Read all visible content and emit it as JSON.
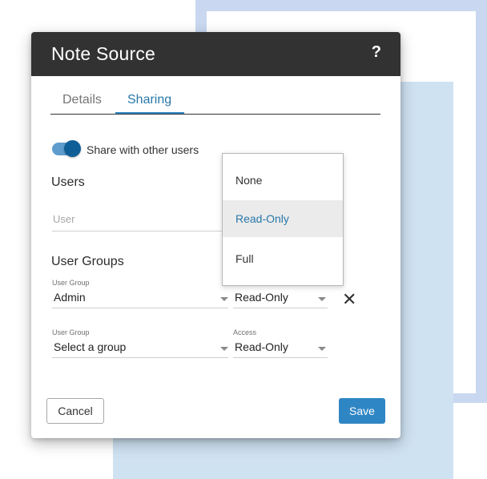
{
  "dialog": {
    "title": "Note Source",
    "help": "?"
  },
  "tabs": [
    {
      "label": "Details",
      "active": false
    },
    {
      "label": "Sharing",
      "active": true
    }
  ],
  "share": {
    "label": "Share with other users",
    "enabled": true
  },
  "users": {
    "title": "Users",
    "placeholder": "User"
  },
  "groups": {
    "title": "User Groups",
    "rows": [
      {
        "group_label": "User Group",
        "group_value": "Admin",
        "access_label": "Access",
        "access_value": "Read-Only"
      },
      {
        "group_label": "User Group",
        "group_value": "Select a group",
        "access_label": "Access",
        "access_value": "Read-Only"
      }
    ]
  },
  "access_menu": {
    "options": [
      "None",
      "Read-Only",
      "Full"
    ],
    "selected": "Read-Only"
  },
  "buttons": {
    "cancel": "Cancel",
    "save": "Save"
  },
  "colors": {
    "header_bg": "#323232",
    "accent": "#2f86c4",
    "toggle_track": "#5e9ccd",
    "toggle_knob": "#0f5e98"
  }
}
